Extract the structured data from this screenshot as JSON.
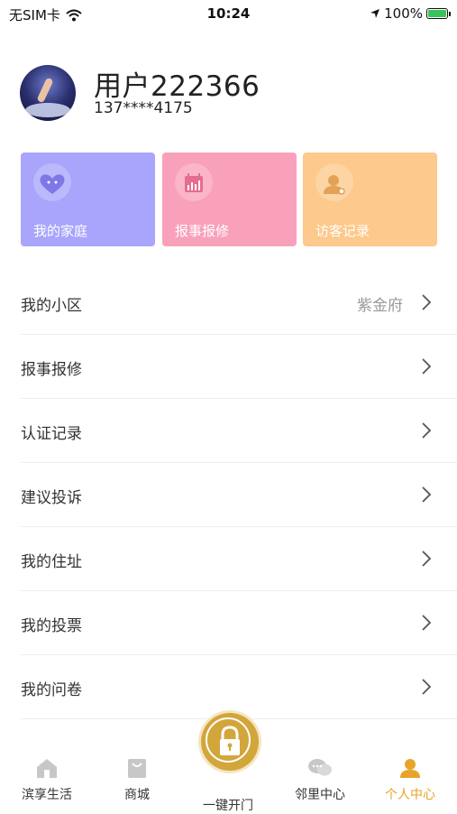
{
  "status_bar": {
    "carrier": "无SIM卡",
    "time": "10:24",
    "battery": "100%"
  },
  "profile": {
    "name": "用户222366",
    "phone": "137****4175"
  },
  "quick_cards": [
    {
      "label": "我的家庭",
      "icon": "heart-icon",
      "color": "#a9a5fc"
    },
    {
      "label": "报事报修",
      "icon": "calendar-chart-icon",
      "color": "#f9a1ba"
    },
    {
      "label": "访客记录",
      "icon": "person-icon",
      "color": "#fdc98c"
    }
  ],
  "menu": [
    {
      "label": "我的小区",
      "value": "紫金府"
    },
    {
      "label": "报事报修",
      "value": ""
    },
    {
      "label": "认证记录",
      "value": ""
    },
    {
      "label": "建议投诉",
      "value": ""
    },
    {
      "label": "我的住址",
      "value": ""
    },
    {
      "label": "我的投票",
      "value": ""
    },
    {
      "label": "我的问卷",
      "value": ""
    }
  ],
  "tabbar": {
    "home": "滨享生活",
    "shop": "商城",
    "open": "一键开门",
    "neighbor": "邻里中心",
    "profile": "个人中心",
    "active_color": "#e6a428",
    "lock_color": "#d2a63b"
  }
}
